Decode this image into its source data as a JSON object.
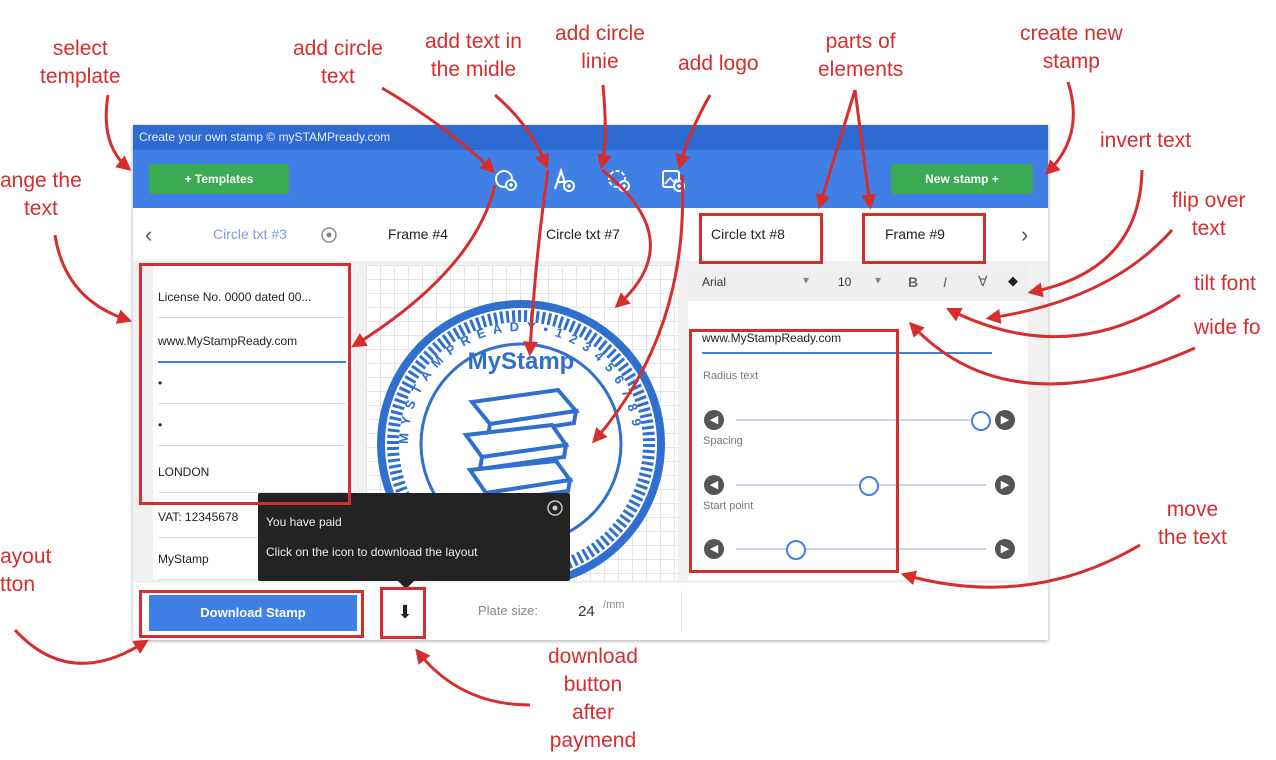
{
  "annotations": {
    "select_template": "select\ntemplate",
    "add_circle_text": "add circle\ntext",
    "add_text_middle": "add text in\nthe midle",
    "add_circle_line": "add circle\nlinie",
    "add_logo": "add logo",
    "parts_of_elements": "parts of\nelements",
    "create_new_stamp": "create new\nstamp",
    "change_text": "ange the\ntext",
    "invert_text": "invert text",
    "flip_over_text": "flip over\ntext",
    "tilt_font": "tilt font",
    "wide_font": "wide fo",
    "move_text": "move\nthe text",
    "layout_button": "ayout\ntton",
    "download_after_payment": "download\nbutton\nafter\npaymend"
  },
  "app": {
    "title": "Create your own stamp © mySTAMPready.com",
    "templates_button": "+ Templates",
    "new_stamp_button": "New stamp +",
    "tabs": [
      "Circle txt #3",
      "Frame #4",
      "Circle txt #7",
      "Circle txt #8",
      "Frame #9"
    ],
    "text_rows": [
      "License No. 0000 dated 00...",
      "www.MyStampReady.com",
      "•",
      "•",
      "LONDON",
      "VAT: 12345678",
      "MyStamp"
    ],
    "stamp_center_text": "MyStamp",
    "stamp_ring_text": "M Y S T A M P  R E A D Y  •  1 2 3 4 5 6 7 8 9",
    "font_name": "Arial",
    "font_size": "10",
    "bold_glyph": "B",
    "italic_glyph": "I",
    "flip_glyph": "∀",
    "invert_glyph": "◆",
    "selected_text": "www.MyStampReady.com",
    "slider_labels": [
      "Radius text",
      "Spacing",
      "Start point"
    ],
    "sliders": [
      0.98,
      0.53,
      0.24
    ],
    "download_button": "Download Stamp",
    "plate_label": "Plate size:",
    "plate_value": "24",
    "plate_unit": "mm",
    "tooltip_title": "You have paid",
    "tooltip_text": "Click on the icon to download the layout"
  },
  "colors": {
    "annotation": "#d62d2d",
    "toolbar": "#3f7fe6",
    "titlebar": "#2d6bd3",
    "button_green": "#3bab53",
    "stamp_blue": "#2f6fd0"
  }
}
